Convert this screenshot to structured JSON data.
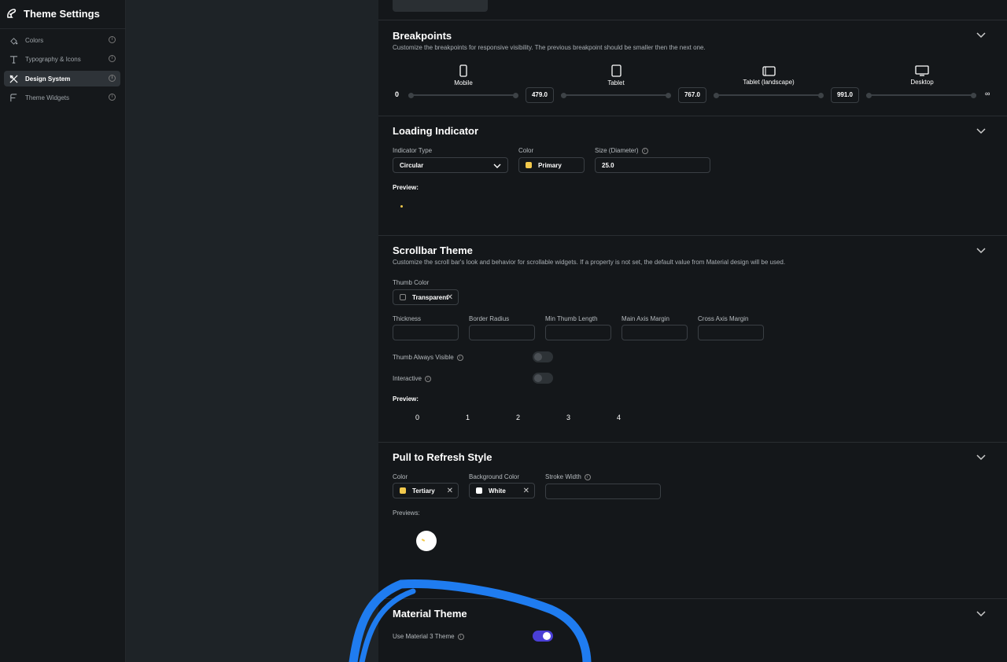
{
  "sidebar": {
    "title": "Theme Settings",
    "items": [
      {
        "label": "Colors",
        "icon": "palette-icon"
      },
      {
        "label": "Typography & Icons",
        "icon": "typography-icon"
      },
      {
        "label": "Design System",
        "icon": "design-system-icon"
      },
      {
        "label": "Theme Widgets",
        "icon": "widgets-icon"
      }
    ],
    "active_index": 2
  },
  "breakpoints": {
    "title": "Breakpoints",
    "description": "Customize the breakpoints for responsive visibility. The previous breakpoint should be smaller then the next one.",
    "start": "0",
    "end": "∞",
    "devices": [
      {
        "label": "Mobile",
        "icon": "mobile-icon"
      },
      {
        "label": "Tablet",
        "icon": "tablet-icon"
      },
      {
        "label": "Tablet (landscape)",
        "icon": "tablet-landscape-icon"
      },
      {
        "label": "Desktop",
        "icon": "desktop-icon"
      }
    ],
    "values": [
      "479.0",
      "767.0",
      "991.0"
    ]
  },
  "loading": {
    "title": "Loading Indicator",
    "type_label": "Indicator Type",
    "type_value": "Circular",
    "color_label": "Color",
    "color_value": "Primary",
    "color_hex": "#f2c94c",
    "size_label": "Size (Diameter)",
    "size_value": "25.0",
    "preview_label": "Preview:"
  },
  "scrollbar": {
    "title": "Scrollbar Theme",
    "description": "Customize the scroll bar's look and behavior for scrollable widgets. If a property is not set, the default value from Material design will be used.",
    "thumb_color_label": "Thumb Color",
    "thumb_color_value": "Transparent",
    "fields": [
      "Thickness",
      "Border Radius",
      "Min Thumb Length",
      "Main Axis Margin",
      "Cross Axis Margin"
    ],
    "thumb_visible_label": "Thumb Always Visible",
    "thumb_visible_on": false,
    "interactive_label": "Interactive",
    "interactive_on": false,
    "preview_label": "Preview:",
    "preview_items": [
      "0",
      "1",
      "2",
      "3",
      "4"
    ]
  },
  "pull": {
    "title": "Pull to Refresh Style",
    "color_label": "Color",
    "color_value": "Tertiary",
    "color_hex": "#f2c94c",
    "bg_label": "Background Color",
    "bg_value": "White",
    "bg_hex": "#ffffff",
    "stroke_label": "Stroke Width",
    "previews_label": "Previews:"
  },
  "material": {
    "title": "Material Theme",
    "m3_label": "Use Material 3 Theme",
    "m3_on": true,
    "accent_hex": "#4a3fd6"
  },
  "annotation_hex": "#1f7cf0"
}
